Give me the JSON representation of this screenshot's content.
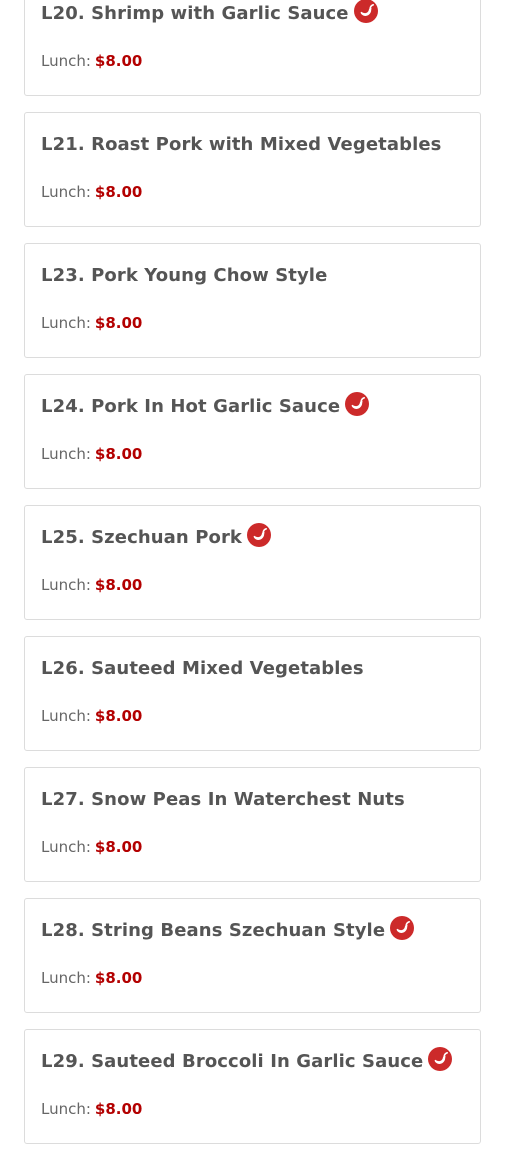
{
  "menu": {
    "spicy_color": "#cc2a2a",
    "items": [
      {
        "code_name": "L20. Shrimp with Garlic Sauce",
        "spicy": true,
        "price_label": "Lunch:",
        "price": "$8.00"
      },
      {
        "code_name": "L21. Roast Pork with Mixed Vegetables",
        "spicy": false,
        "price_label": "Lunch:",
        "price": "$8.00"
      },
      {
        "code_name": "L23. Pork Young Chow Style",
        "spicy": false,
        "price_label": "Lunch:",
        "price": "$8.00"
      },
      {
        "code_name": "L24. Pork In Hot Garlic Sauce",
        "spicy": true,
        "price_label": "Lunch:",
        "price": "$8.00"
      },
      {
        "code_name": "L25. Szechuan Pork",
        "spicy": true,
        "price_label": "Lunch:",
        "price": "$8.00"
      },
      {
        "code_name": "L26. Sauteed Mixed Vegetables",
        "spicy": false,
        "price_label": "Lunch:",
        "price": "$8.00"
      },
      {
        "code_name": "L27. Snow Peas In Waterchest Nuts",
        "spicy": false,
        "price_label": "Lunch:",
        "price": "$8.00"
      },
      {
        "code_name": "L28. String Beans Szechuan Style",
        "spicy": true,
        "price_label": "Lunch:",
        "price": "$8.00"
      },
      {
        "code_name": "L29. Sauteed Broccoli In Garlic Sauce",
        "spicy": true,
        "price_label": "Lunch:",
        "price": "$8.00"
      }
    ]
  }
}
